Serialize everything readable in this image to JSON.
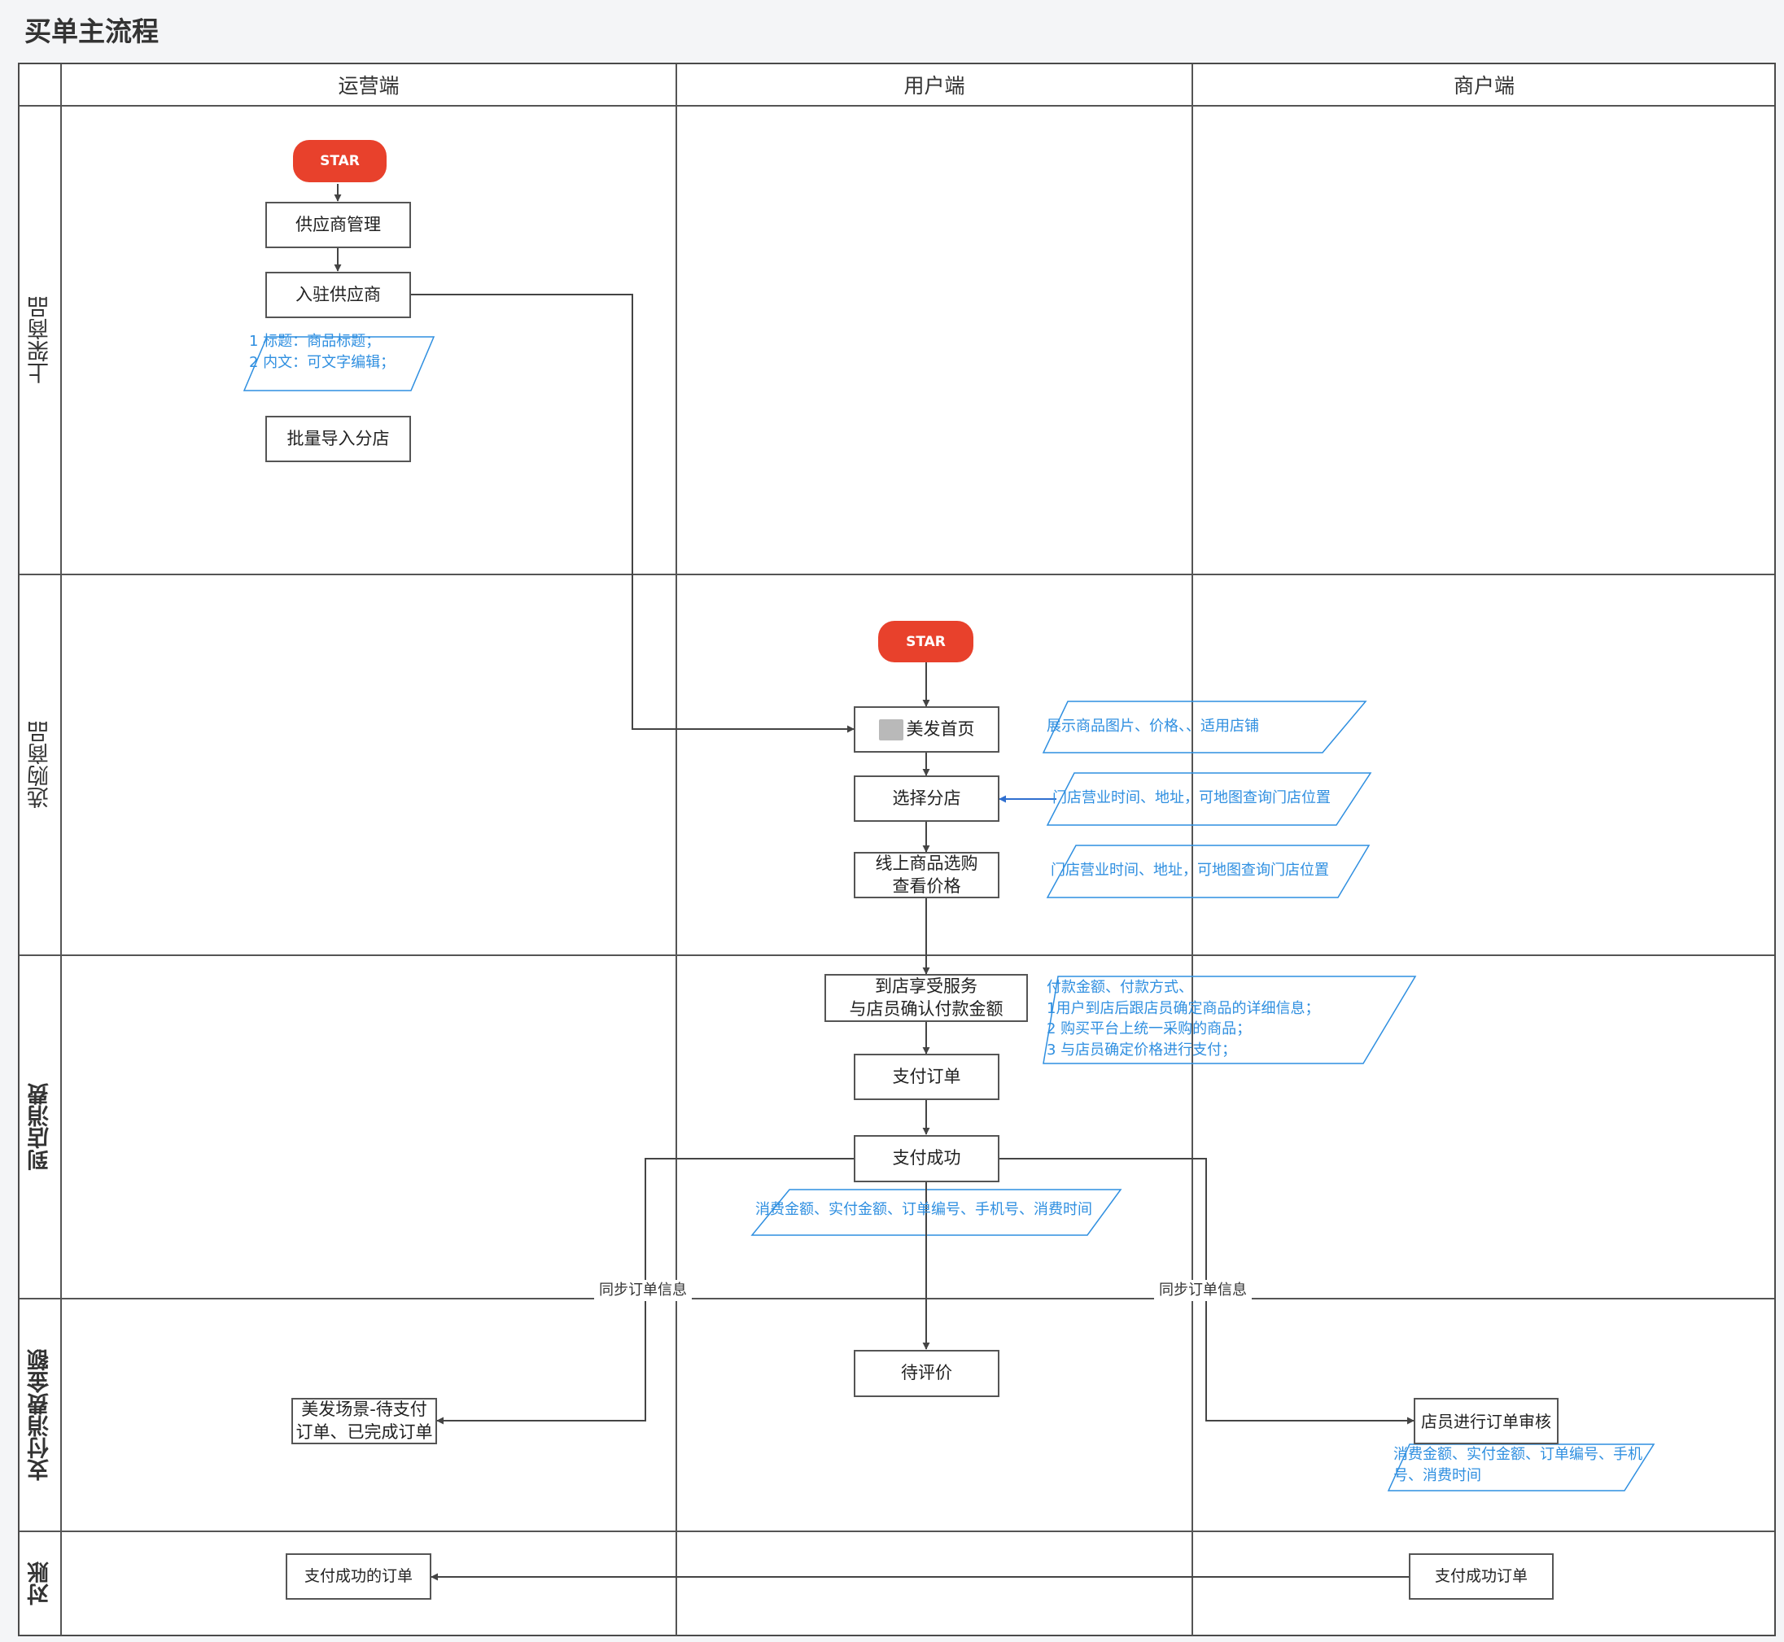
{
  "page_title": "买单主流程",
  "columns": [
    "运营端",
    "用户端",
    "商户端"
  ],
  "lanes": [
    "上架商品",
    "选购商品",
    "到店消费",
    "支付消费金额",
    "对账"
  ],
  "colors": {
    "start": "#e8412c",
    "note": "#2f8fe0",
    "line": "#444444",
    "highlight_line": "#2f6fd0"
  },
  "nodes": {
    "start_ops": "STAR",
    "supplier_mgmt": "供应商管理",
    "onboard_supplier": "入驻供应商",
    "batch_import": "批量导入分店",
    "start_user": "STAR",
    "homepage": "美发首页",
    "choose_store": "选择分店",
    "online_select_1": "线上商品选购",
    "online_select_2": "查看价格",
    "in_store_1": "到店享受服务",
    "in_store_2": "与店员确认付款金额",
    "pay_order": "支付订单",
    "pay_success": "支付成功",
    "pending_review": "待评价",
    "ops_orders_1": "美发场景-待支付",
    "ops_orders_2": "订单、已完成订单",
    "merchant_review": "店员进行订单审核",
    "ops_paid_orders": "支付成功的订单",
    "merchant_paid_orders": "支付成功订单"
  },
  "notes": {
    "ops_note_1": "1 标题：商品标题；",
    "ops_note_2": "2 内文：可文字编辑；",
    "homepage_note": "展示商品图片、价格、、适用店铺",
    "store_note": "门店营业时间、地址，可地图查询门店位置",
    "price_note": "门店营业时间、地址，可地图查询门店位置",
    "pay_note_1": "付款金额、付款方式、",
    "pay_note_2": "1用户到店后跟店员确定商品的详细信息；",
    "pay_note_3": "2 购买平台上统一采购的商品；",
    "pay_note_4": "3 与店员确定价格进行支付；",
    "success_note": "消费金额、实付金额、订单编号、手机号、消费时间",
    "merchant_note_1": "消费金额、实付金额、订单编号、手机",
    "merchant_note_2": "号、消费时间"
  },
  "edge_labels": {
    "sync_left": "同步订单信息",
    "sync_right": "同步订单信息"
  }
}
